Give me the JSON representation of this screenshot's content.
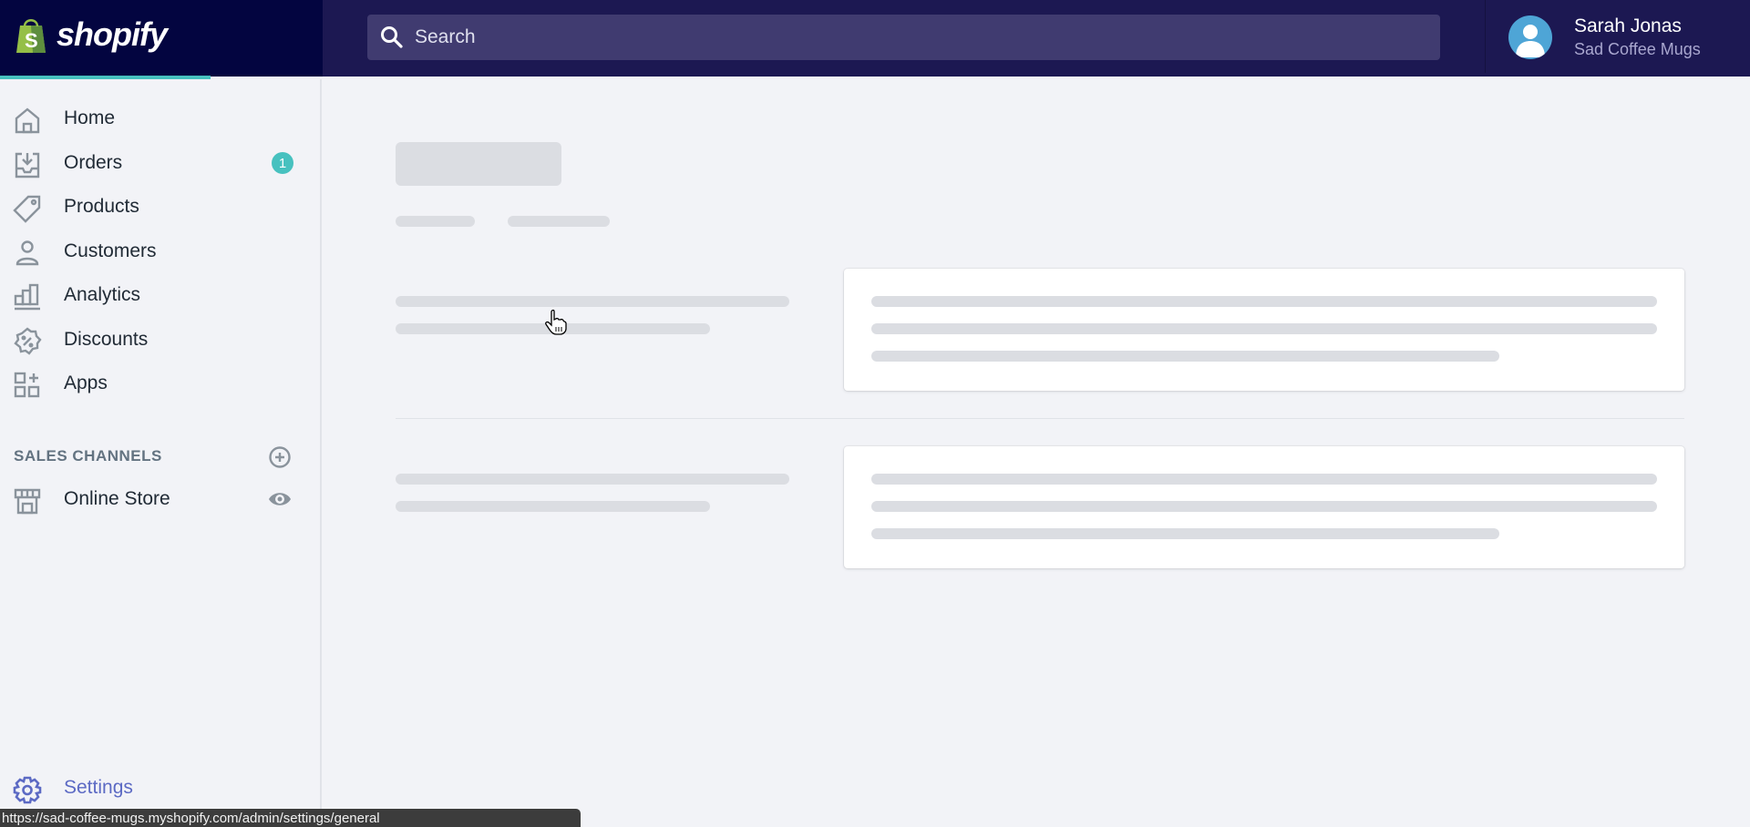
{
  "brand": {
    "name": "shopify"
  },
  "search": {
    "placeholder": "Search",
    "icon": "search-icon"
  },
  "user": {
    "name": "Sarah Jonas",
    "store": "Sad Coffee Mugs"
  },
  "nav": {
    "items": [
      {
        "label": "Home",
        "icon": "home-icon"
      },
      {
        "label": "Orders",
        "icon": "orders-icon",
        "badge": "1"
      },
      {
        "label": "Products",
        "icon": "tag-icon"
      },
      {
        "label": "Customers",
        "icon": "customer-icon"
      },
      {
        "label": "Analytics",
        "icon": "analytics-icon"
      },
      {
        "label": "Discounts",
        "icon": "discount-icon"
      },
      {
        "label": "Apps",
        "icon": "apps-icon"
      }
    ],
    "sales_channels": {
      "heading": "SALES CHANNELS",
      "items": [
        {
          "label": "Online Store",
          "icon": "store-icon"
        }
      ]
    },
    "settings": {
      "label": "Settings",
      "icon": "gear-icon"
    }
  },
  "colors": {
    "topbar": "#1c1852",
    "brand_bg": "#030540",
    "accent": "#47c1bf",
    "settings": "#5c6ac4"
  },
  "status_bar": {
    "url": "https://sad-coffee-mugs.myshopify.com/admin/settings/general"
  },
  "page": {
    "state": "loading"
  }
}
